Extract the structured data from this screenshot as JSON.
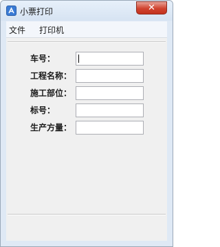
{
  "window": {
    "title": "小票打印",
    "close_label": "✕"
  },
  "menu": {
    "items": [
      {
        "label": "文件"
      },
      {
        "label": "打印机"
      }
    ]
  },
  "form": {
    "fields": [
      {
        "label": "车号：",
        "value": "",
        "focused": true
      },
      {
        "label": "工程名称：",
        "value": ""
      },
      {
        "label": "施工部位：",
        "value": ""
      },
      {
        "label": "标号：",
        "value": ""
      },
      {
        "label": "生产方量：",
        "value": ""
      }
    ]
  },
  "colors": {
    "accent": "#3a7bd5",
    "close_button": "#d0432f",
    "frame": "#dfe9f5"
  }
}
